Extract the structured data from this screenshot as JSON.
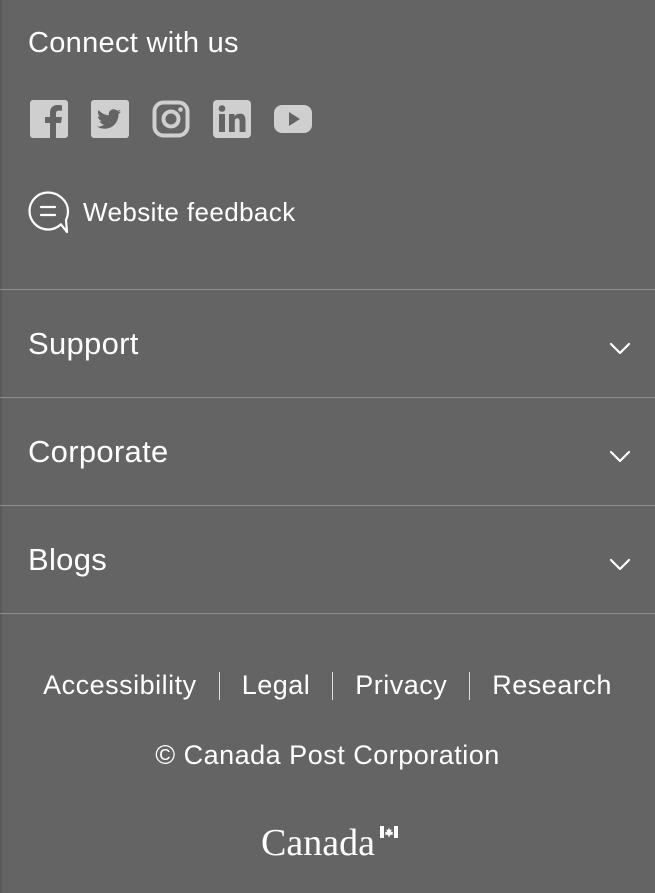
{
  "connect": {
    "title": "Connect with us",
    "social": [
      {
        "name": "facebook-icon"
      },
      {
        "name": "twitter-icon"
      },
      {
        "name": "instagram-icon"
      },
      {
        "name": "linkedin-icon"
      },
      {
        "name": "youtube-icon"
      }
    ],
    "feedback_label": "Website feedback"
  },
  "accordion": {
    "items": [
      {
        "label": "Support"
      },
      {
        "label": "Corporate"
      },
      {
        "label": "Blogs"
      }
    ]
  },
  "legal": {
    "links": [
      "Accessibility",
      "Legal",
      "Privacy",
      "Research"
    ]
  },
  "copyright": "© Canada Post Corporation",
  "wordmark": "Canada",
  "colors": {
    "background": "#646464",
    "text": "#ffffff",
    "icon": "#cfcfcf",
    "divider": "#8e8e8e"
  }
}
